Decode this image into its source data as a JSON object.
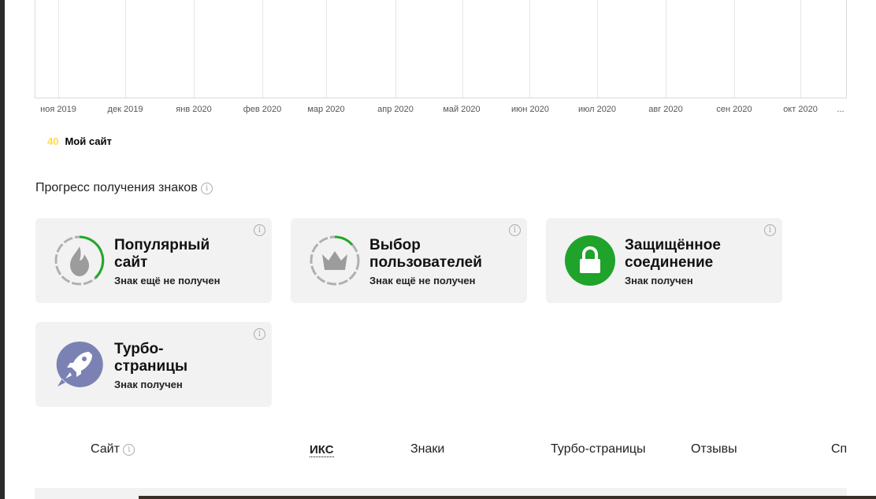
{
  "chart": {
    "ticks": [
      "ноя 2019",
      "дек 2019",
      "янв 2020",
      "фев 2020",
      "мар 2020",
      "апр 2020",
      "май 2020",
      "июн 2020",
      "июл 2020",
      "авг 2020",
      "сен 2020",
      "окт 2020",
      "..."
    ],
    "legend": {
      "value": "40",
      "label": "Мой сайт"
    }
  },
  "badges": {
    "title": "Прогресс получения знаков",
    "cards": [
      {
        "title_line1": "Популярный",
        "title_line2": "сайт",
        "status": "Знак ещё не получен",
        "icon": "flame-icon"
      },
      {
        "title_line1": "Выбор",
        "title_line2": "пользователей",
        "status": "Знак ещё не получен",
        "icon": "crown-icon"
      },
      {
        "title_line1": "Защищённое",
        "title_line2": "соединение",
        "status": "Знак получен",
        "icon": "lock-icon"
      },
      {
        "title_line1": "Турбо-",
        "title_line2": "страницы",
        "status": "Знак получен",
        "icon": "rocket-icon"
      }
    ]
  },
  "table": {
    "headers": [
      "Сайт",
      "ИКС",
      "Знаки",
      "Турбо-страницы",
      "Отзывы",
      "Сп"
    ]
  },
  "colors": {
    "accent_yellow": "#ffdb4d",
    "green": "#1fa32b",
    "turbo": "#7b82b3",
    "progress_green": "#22a82a"
  }
}
